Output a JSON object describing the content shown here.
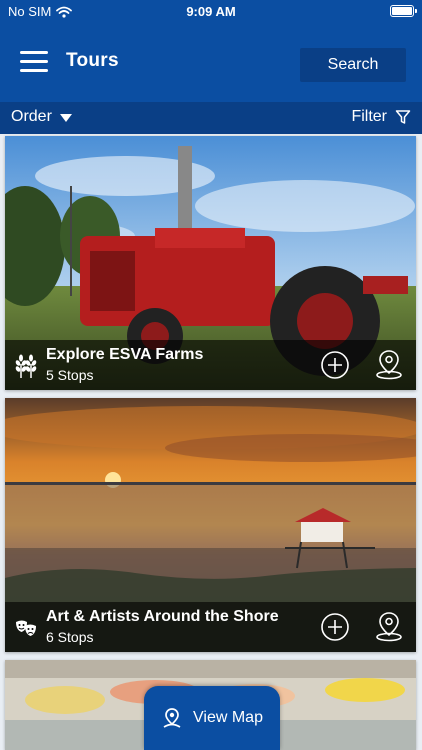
{
  "status": {
    "carrier": "No SIM",
    "time": "9:09 AM"
  },
  "nav": {
    "title": "Tours",
    "search_label": "Search"
  },
  "toolbar": {
    "order_label": "Order",
    "filter_label": "Filter"
  },
  "tours": [
    {
      "name": "Explore ESVA Farms",
      "stops": "5 Stops",
      "category_icon": "wheat-icon"
    },
    {
      "name": "Art & Artists Around the Shore",
      "stops": "6 Stops",
      "category_icon": "theater-masks-icon"
    }
  ],
  "view_map_label": "View Map",
  "colors": {
    "primary": "#0b4ea2",
    "primary_dark": "#0a3f86",
    "white": "#ffffff"
  }
}
